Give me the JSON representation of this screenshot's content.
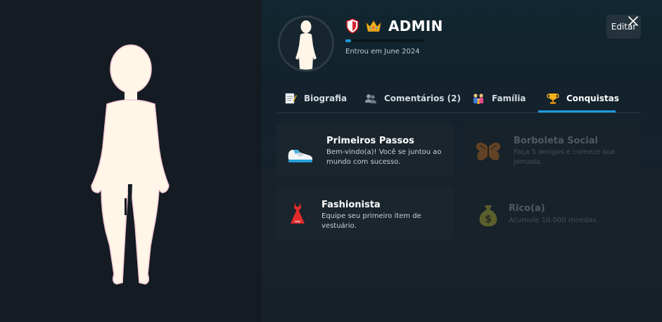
{
  "profile": {
    "username": "ADMIN",
    "joined": "Entrou em June 2024",
    "xp_progress": 0.07,
    "badges": [
      "shield-badge",
      "crown-badge"
    ],
    "edit_label": "Editar",
    "close_icon": "close-icon"
  },
  "tabs": [
    {
      "label": "Biografia",
      "icon": "notepad-icon",
      "active": false
    },
    {
      "label": "Comentários (2)",
      "icon": "people-icon",
      "active": false
    },
    {
      "label": "Família",
      "icon": "family-icon",
      "active": false
    },
    {
      "label": "Conquistas",
      "icon": "trophy-icon",
      "active": true
    }
  ],
  "achievements": [
    {
      "title": "Primeiros Passos",
      "desc": "Bem-vindo(a)! Você se juntou ao mundo com sucesso.",
      "icon": "sneaker-icon",
      "unlocked": true
    },
    {
      "title": "Borboleta Social",
      "desc": "Faça 5 amigos e comece sua jornada.",
      "icon": "butterfly-icon",
      "unlocked": false
    },
    {
      "title": "Fashionista",
      "desc": "Equipe seu primeiro item de vestuário.",
      "icon": "dress-icon",
      "unlocked": true
    },
    {
      "title": "Rico(a)",
      "desc": "Acumule 10.000 moedas.",
      "icon": "money-bag-icon",
      "unlocked": false
    }
  ],
  "colors": {
    "accent": "#1e9ae0",
    "background_left": "#141b22",
    "background_right": "#17212a",
    "card": "#1a252d",
    "avatar_skin": "#fff6e8"
  }
}
